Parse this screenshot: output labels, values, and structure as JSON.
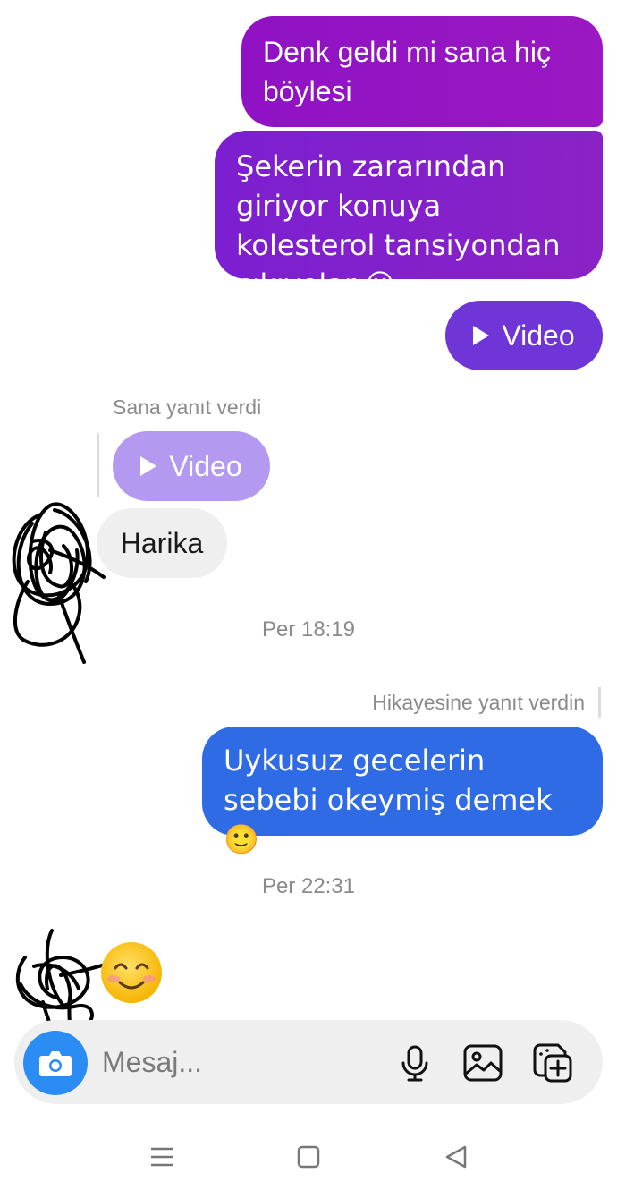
{
  "messages": {
    "out1": "Denk geldi mi sana hiç böylesi",
    "out2": "Şekerin zararından giriyor konuya kolesterol tansiyondan çıkıyolar 😃",
    "out_video_label": "Video",
    "reply_note": "Sana yanıt verdi",
    "reply_video_label": "Video",
    "in_harika": "Harika",
    "timestamp1": "Per 18:19",
    "story_note": "Hikayesine yanıt verdin",
    "out3": "Uykusuz gecelerin sebebi okeymiş demek 🙂",
    "timestamp2": "Per 22:31"
  },
  "composer": {
    "placeholder": "Mesaj...",
    "icons": [
      "camera-icon",
      "microphone-icon",
      "gallery-icon",
      "sticker-icon"
    ]
  },
  "navbar": {
    "icons": [
      "menu-icon",
      "home-icon",
      "back-icon"
    ]
  },
  "colors": {
    "bubble_purple": "#8f12c4",
    "bubble_violet": "#7c1fd0",
    "video_bubble": "#6f35d6",
    "reply_video": "#b39af0",
    "bubble_blue": "#2f6be5",
    "camera_button": "#2b8df3"
  }
}
